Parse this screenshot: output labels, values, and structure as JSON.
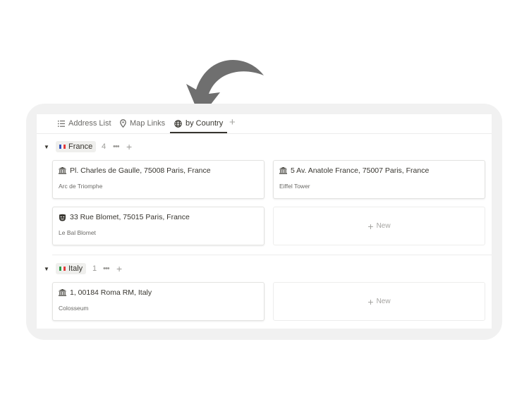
{
  "tabs": [
    {
      "label": "Address List",
      "icon": "list-icon",
      "active": false
    },
    {
      "label": "Map Links",
      "icon": "map-pin-icon",
      "active": false
    },
    {
      "label": "by Country",
      "icon": "globe-icon",
      "active": true
    }
  ],
  "add_view_label": "+",
  "groups": [
    {
      "name": "France",
      "flag": "france-flag",
      "count": "4",
      "cards": [
        {
          "icon": "museum-icon",
          "title": "Pl. Charles de Gaulle, 75008 Paris, France",
          "subtitle": "Arc de Triomphe"
        },
        {
          "icon": "museum-icon",
          "title": "5 Av. Anatole France, 75007 Paris, France",
          "subtitle": "Eiffel Tower"
        },
        {
          "icon": "theater-masks-icon",
          "title": "33 Rue Blomet, 75015 Paris, France",
          "subtitle": "Le Bal Blomet"
        }
      ],
      "new_label": "New"
    },
    {
      "name": "Italy",
      "flag": "italy-flag",
      "count": "1",
      "cards": [
        {
          "icon": "museum-icon",
          "title": "1, 00184 Roma RM, Italy",
          "subtitle": "Colosseum"
        }
      ],
      "new_label": "New"
    }
  ],
  "group_more_label": "•••",
  "group_add_label": "+",
  "new_plus": "+",
  "colors": {
    "accent": "#37352f",
    "arrow": "#6f6f6f",
    "frame": "#f1f1f1"
  }
}
